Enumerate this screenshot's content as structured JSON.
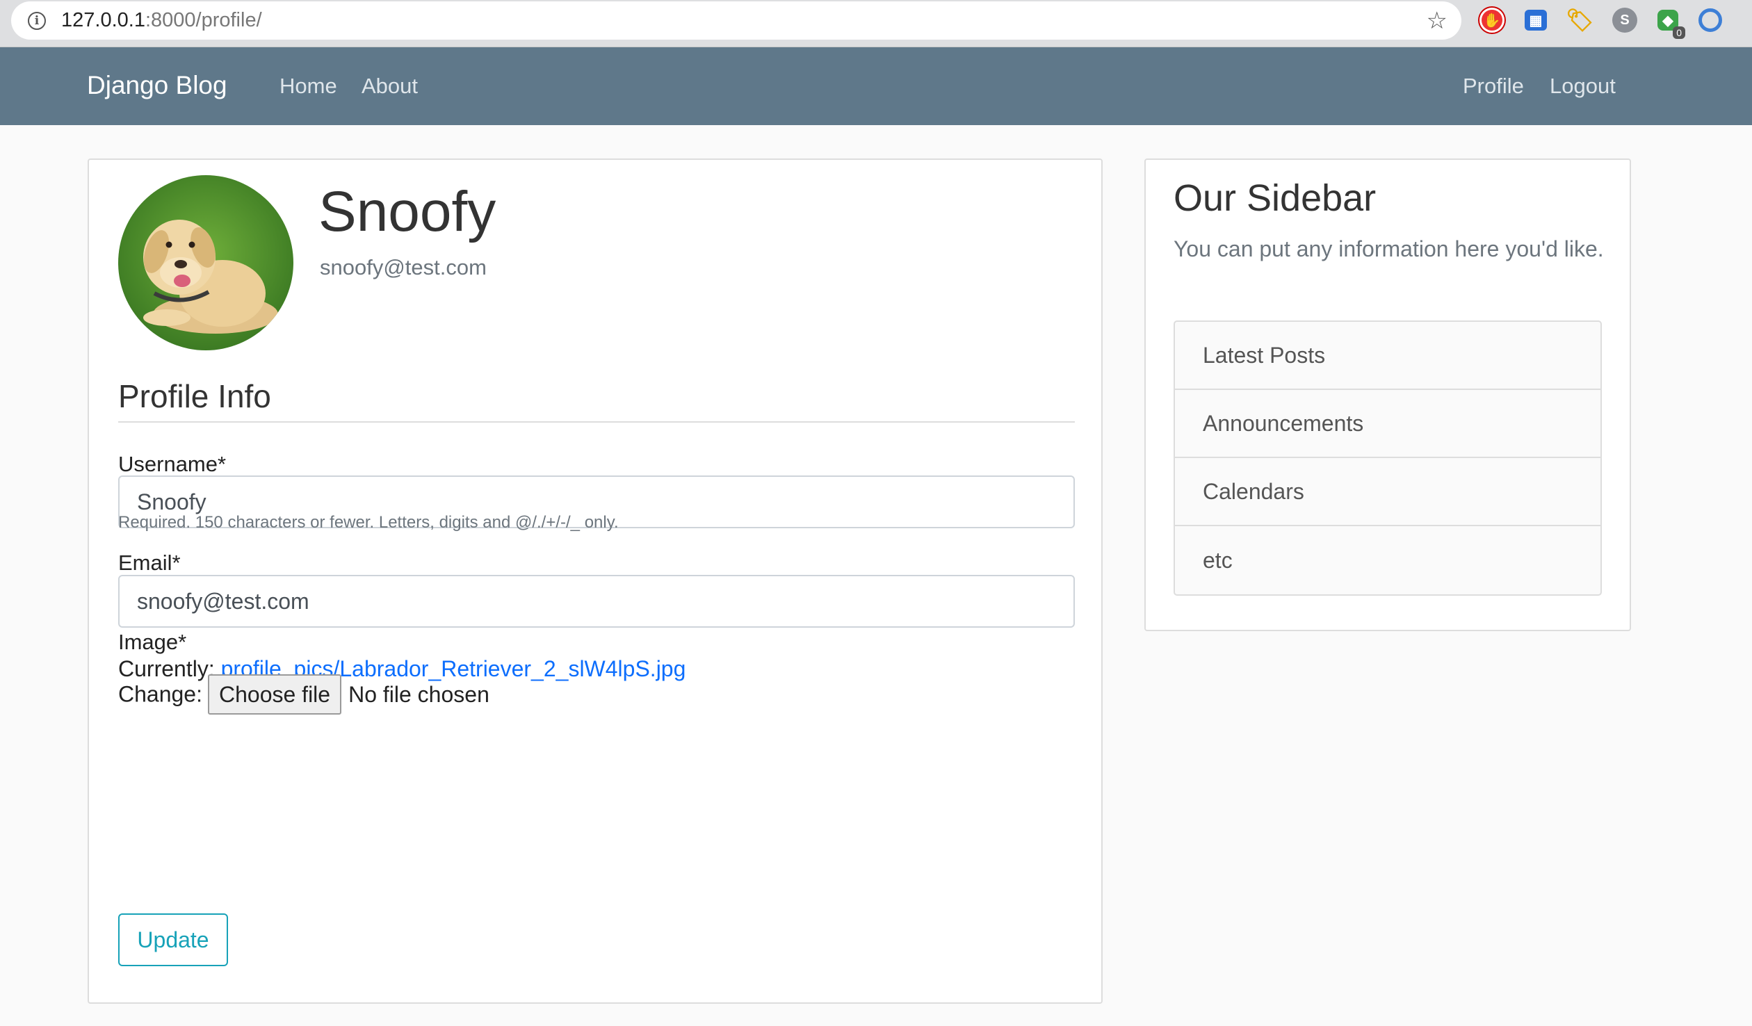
{
  "browser": {
    "url_host": "127.0.0.1",
    "url_port_path": ":8000/profile/",
    "extension_badge": "0"
  },
  "navbar": {
    "brand": "Django Blog",
    "home": "Home",
    "about": "About",
    "profile": "Profile",
    "logout": "Logout"
  },
  "profile": {
    "username": "Snoofy",
    "email": "snoofy@test.com"
  },
  "form": {
    "section_title": "Profile Info",
    "username_label": "Username*",
    "username_value": "Snoofy",
    "username_help": "Required. 150 characters or fewer. Letters, digits and @/./+/-/_ only.",
    "email_label": "Email*",
    "email_value": "snoofy@test.com",
    "image_label": "Image*",
    "currently_label": "Currently:",
    "current_file": "profile_pics/Labrador_Retriever_2_slW4lpS.jpg",
    "change_label": "Change:",
    "choose_file": "Choose file",
    "no_file": "No file chosen",
    "submit": "Update"
  },
  "sidebar": {
    "title": "Our Sidebar",
    "text": "You can put any information here you'd like.",
    "items": [
      {
        "label": "Latest Posts"
      },
      {
        "label": "Announcements"
      },
      {
        "label": "Calendars"
      },
      {
        "label": "etc"
      }
    ]
  },
  "colors": {
    "navbar": "#5f788a",
    "accent_info": "#17a2b8",
    "link": "#0d6efd"
  }
}
